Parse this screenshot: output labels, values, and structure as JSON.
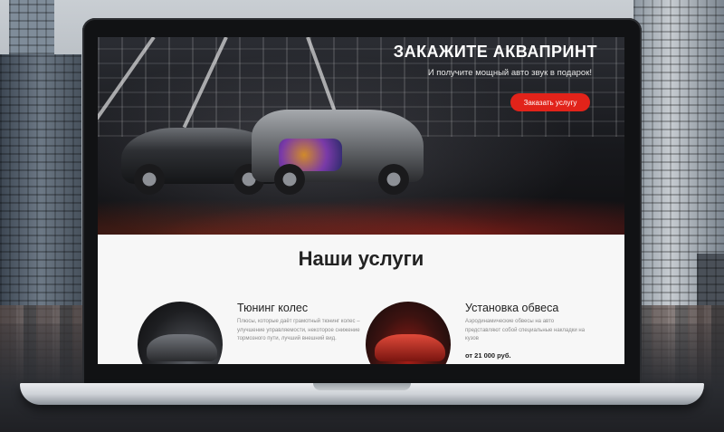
{
  "hero": {
    "title": "ЗАКАЖИТЕ АКВАПРИНТ",
    "subtitle": "И получите мощный авто звук в подарок!",
    "cta_label": "Заказать услугу"
  },
  "services": {
    "heading": "Наши услуги",
    "items": [
      {
        "title": "Тюнинг колес",
        "description": "Плюсы, которые даёт грамотный тюнинг колес – улучшение управляемости, некоторое снижение тормозного пути, лучший внешний вид.",
        "price": "",
        "image_icon": "wheel-car-photo"
      },
      {
        "title": "Установка обвеса",
        "description": "Аэродинамические обвесы на авто представляют собой специальные накладки на кузов",
        "price": "от 21 000 руб.",
        "image_icon": "red-car-photo"
      }
    ]
  },
  "colors": {
    "accent": "#e2231a",
    "heading_text": "#222222",
    "muted_text": "#8a8a8a"
  }
}
